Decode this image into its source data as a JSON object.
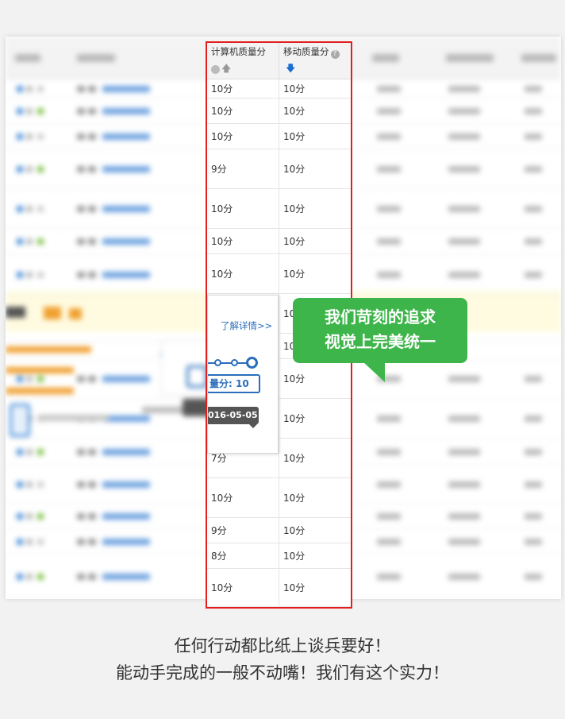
{
  "headers": {
    "pc_quality": "计算机质量分",
    "mobile_quality": "移动质量分",
    "help_glyph": "?",
    "mobile_sort_icon": "arrow-down-icon",
    "pc_sort_icon": "arrow-up-icon"
  },
  "rows": [
    {
      "pc": "10分",
      "mobile": "10分"
    },
    {
      "pc": "10分",
      "mobile": "10分"
    },
    {
      "pc": "10分",
      "mobile": "10分"
    },
    {
      "pc": "9分",
      "mobile": "10分"
    },
    {
      "pc": "10分",
      "mobile": "10分"
    },
    {
      "pc": "10分",
      "mobile": "10分"
    },
    {
      "pc": "10分",
      "mobile": "10分"
    },
    {
      "pc": "",
      "mobile": "10"
    },
    {
      "pc": "",
      "mobile": "10"
    },
    {
      "pc": "",
      "mobile": "10分"
    },
    {
      "pc": "",
      "mobile": "10分"
    },
    {
      "pc": "7分",
      "mobile": "10分"
    },
    {
      "pc": "10分",
      "mobile": "10分"
    },
    {
      "pc": "9分",
      "mobile": "10分"
    },
    {
      "pc": "8分",
      "mobile": "10分"
    },
    {
      "pc": "10分",
      "mobile": "10分"
    }
  ],
  "popup": {
    "more_link": "了解详情>>",
    "score_text": "量分: 10",
    "date_text": "016-05-05"
  },
  "callout": {
    "line1": "我们苛刻的追求",
    "line2": "视觉上完美统一",
    "color": "#3db54a"
  },
  "highlight_color": "#e41e1e",
  "caption": {
    "line1": "任何行动都比纸上谈兵要好！",
    "line2": "能动手完成的一般不动嘴！我们有这个实力！"
  }
}
